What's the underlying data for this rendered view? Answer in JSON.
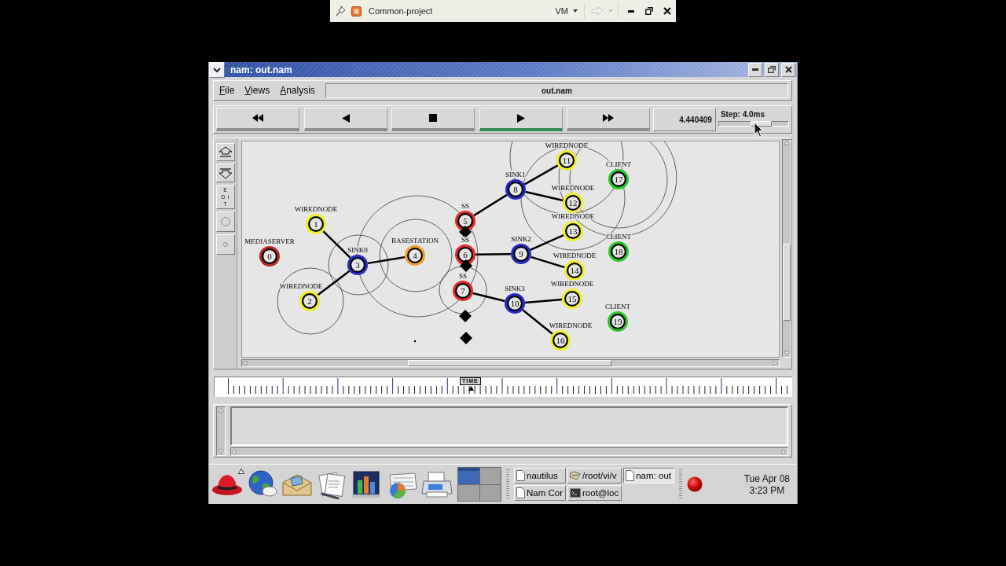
{
  "host_bar": {
    "title": "Common-project",
    "menu": "VM"
  },
  "window": {
    "title": "nam: out.nam"
  },
  "menu_bar": {
    "items": [
      "File",
      "Views",
      "Analysis"
    ],
    "file_name": "out.nam"
  },
  "playback": {
    "buttons": [
      {
        "kind": "rewind",
        "selected": false
      },
      {
        "kind": "reverse",
        "selected": false
      },
      {
        "kind": "stop",
        "selected": false
      },
      {
        "kind": "play",
        "selected": true
      },
      {
        "kind": "forward",
        "selected": false
      }
    ],
    "time": "4.440409",
    "step": {
      "label": "Step: 4.0ms",
      "level": 0.62
    }
  },
  "tools": [
    {
      "kind": "zoom_in"
    },
    {
      "kind": "zoom_out"
    },
    {
      "kind": "edit",
      "label": "EDIT"
    },
    {
      "kind": "circle"
    },
    {
      "kind": "dot"
    }
  ],
  "canvas": {
    "nodes": [
      {
        "label": "MEDIASERVER",
        "number": "0",
        "color": "#b82828"
      },
      {
        "label": "WIREDNODE",
        "number": "1",
        "color": "#f0f028"
      },
      {
        "label": "WIREDNODE",
        "number": "2",
        "color": "#f0f028"
      },
      {
        "label": "SINK0",
        "number": "3",
        "color": "#2828c8"
      },
      {
        "label": "BASESTATION",
        "number": "4",
        "color": "#f0a028"
      },
      {
        "label": "SS",
        "number": "5",
        "color": "#e02828"
      },
      {
        "label": "SS",
        "number": "6",
        "color": "#e02828"
      },
      {
        "label": "SS",
        "number": "7",
        "color": "#e02828"
      },
      {
        "label": "SINK1",
        "number": "8",
        "color": "#2828c8"
      },
      {
        "label": "SINK2",
        "number": "9",
        "color": "#2828c8"
      },
      {
        "label": "SINK3",
        "number": "10",
        "color": "#2828c8"
      },
      {
        "label": "WIREDNODE",
        "number": "11",
        "color": "#f0f028"
      },
      {
        "label": "WIREDNODE",
        "number": "12",
        "color": "#f0f028"
      },
      {
        "label": "WIREDNODE",
        "number": "13",
        "color": "#f0f028"
      },
      {
        "label": "WIREDNODE",
        "number": "14",
        "color": "#f0f028"
      },
      {
        "label": "WIREDNODE",
        "number": "15",
        "color": "#f0f028"
      },
      {
        "label": "WIREDNODE",
        "number": "16",
        "color": "#f0f028"
      },
      {
        "label": "CLIENT",
        "number": "17",
        "color": "#28c828"
      },
      {
        "label": "CLIENT",
        "number": "18",
        "color": "#28c828"
      },
      {
        "label": "CLIENT",
        "number": "19",
        "color": "#28c828"
      }
    ]
  },
  "timeline": {
    "label": "TIME"
  },
  "taskbar": {
    "workspaces": [
      {
        "selected": true
      },
      {
        "selected": false
      },
      {
        "selected": false
      },
      {
        "selected": false
      }
    ],
    "tasks": [
      {
        "kind": "document",
        "label": "nautilus",
        "selected": false
      },
      {
        "kind": "folder",
        "label": "/root/vi/v",
        "selected": false
      },
      {
        "kind": "document",
        "label": "nam: out",
        "selected": true
      },
      {
        "kind": "document",
        "label": "Nam Cor",
        "selected": false
      },
      {
        "kind": "terminal",
        "label": "root@loc",
        "selected": false
      }
    ],
    "clock": {
      "date": "Tue Apr 08",
      "time": "3:23 PM"
    }
  }
}
